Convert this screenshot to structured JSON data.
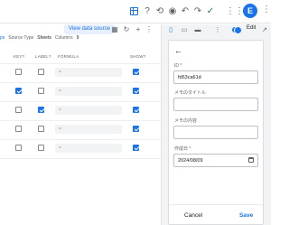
{
  "toolbar": {
    "icons": [
      "grid-icon",
      "help-icon",
      "history-icon",
      "eye-icon",
      "undo-icon",
      "redo-icon",
      "check-icon"
    ],
    "avatar_letter": "E"
  },
  "table": {
    "view_source_label": "View data source",
    "meta": {
      "prefix": "ps",
      "source_type_label": "Source Type",
      "source_type_value": "Sheets",
      "columns_label": "Columns",
      "columns_count": "9"
    },
    "headers": {
      "key": "KEY?",
      "label": "LABEL?",
      "formula": "FORMULA",
      "show": "SHOW?"
    },
    "rows": [
      {
        "key": false,
        "label": false,
        "formula": "=",
        "show": true
      },
      {
        "key": true,
        "label": false,
        "formula": "=",
        "show": true
      },
      {
        "key": false,
        "label": true,
        "formula": "=",
        "show": true
      },
      {
        "key": false,
        "label": false,
        "formula": "=",
        "show": true
      },
      {
        "key": false,
        "label": false,
        "formula": "=",
        "show": true
      }
    ]
  },
  "preview": {
    "edit_label": "Edit",
    "form": {
      "id_label": "ID *",
      "id_value": "fd63ca61d",
      "title_label": "メモのタイトル",
      "title_value": "",
      "content_label": "メモの内容",
      "content_value": "",
      "date_label": "作成日 *",
      "date_value": "2024/08/09"
    },
    "cancel_label": "Cancel",
    "save_label": "Save"
  }
}
